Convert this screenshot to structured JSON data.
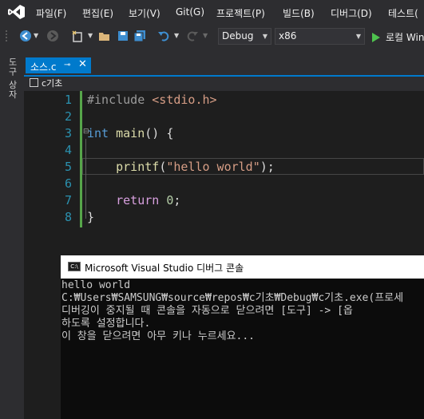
{
  "menu": {
    "items": [
      "파일(F)",
      "편집(E)",
      "보기(V)",
      "Git(G)",
      "프로젝트(P)",
      "빌드(B)",
      "디버그(D)",
      "테스트("
    ]
  },
  "toolbar": {
    "config": "Debug",
    "platform": "x86",
    "run_label": "로컬 Win"
  },
  "side": {
    "toolbox_label": "도구 상자"
  },
  "tab": {
    "label": "소스.c",
    "pin": "⊸",
    "close": "✕"
  },
  "navbar": {
    "project": "c기초"
  },
  "editor": {
    "line_numbers": [
      "1",
      "2",
      "3",
      "4",
      "5",
      "6",
      "7",
      "8"
    ],
    "line1": {
      "directive": "#include",
      "header": "<stdio.h>"
    },
    "line3": {
      "type": "int",
      "name": "main",
      "rest": "() {"
    },
    "line5": {
      "fn": "printf",
      "open": "(",
      "str": "\"hello world\"",
      "close": ");"
    },
    "line7": {
      "kw": "return",
      "num": "0",
      "semi": ";"
    },
    "line8": {
      "brace": "}"
    }
  },
  "console": {
    "title": "Microsoft Visual Studio 디버그 콘솔",
    "icon_text": "C:\\",
    "lines": [
      "hello world",
      "C:₩Users₩SAMSUNG₩source₩repos₩c기초₩Debug₩c기초.exe(프로세",
      "디버깅이 중지될 때 콘솔을 자동으로 닫으려면 [도구] -> [옵",
      "하도록 설정합니다.",
      "이 창을 닫으려면 아무 키나 누르세요..."
    ]
  },
  "colors": {
    "accent": "#007acc",
    "keyword": "#569cd6",
    "string": "#d69d85",
    "function": "#dcdcaa",
    "control": "#d8a0df",
    "number": "#b5cea8",
    "line_number": "#2b91af",
    "change_bar": "#57a64a"
  }
}
